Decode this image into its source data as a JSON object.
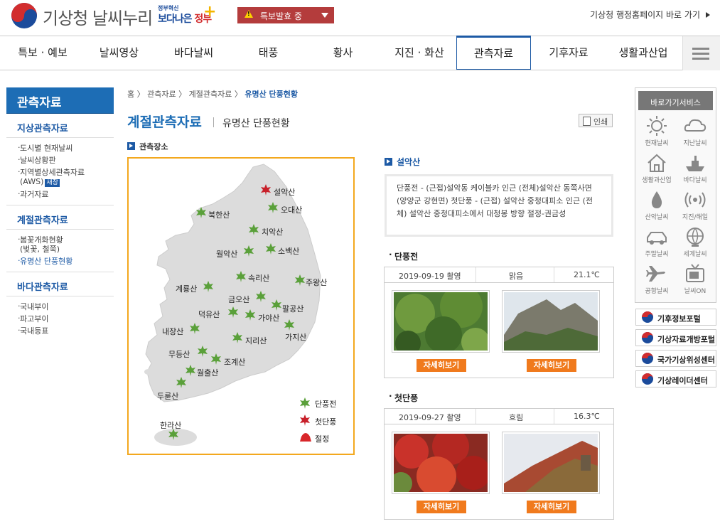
{
  "header": {
    "site_name": "기상청 날씨누리",
    "gov_slogan_small": "정부혁신",
    "gov_slogan_a": "보다나은",
    "gov_slogan_b": "정부",
    "alert_label": "특보발효 중",
    "kma_link": "기상청 행정홈페이지 바로 가기"
  },
  "gnb": [
    "특보 · 예보",
    "날씨영상",
    "바다날씨",
    "태풍",
    "황사",
    "지진 · 화산",
    "관측자료",
    "기후자료",
    "생활과산업"
  ],
  "gnb_active": "관측자료",
  "lnb": {
    "title": "관측자료",
    "sections": [
      {
        "label": "지상관측자료",
        "items": [
          "도시별 현재날씨",
          "날씨상황판",
          "지역별상세관측자료",
          "(AWS)",
          "과거자료"
        ],
        "new_badge": "새창"
      },
      {
        "label": "계절관측자료",
        "items": [
          "봄꽃개화현황",
          "(벚꽃, 철쭉)",
          "유명산 단풍현황"
        ]
      },
      {
        "label": "바다관측자료",
        "items": [
          "국내부이",
          "파고부이",
          "국내등표"
        ]
      }
    ]
  },
  "breadcrumb": {
    "home": "홈",
    "l1": "관측자료",
    "l2": "계절관측자료",
    "current": "유명산 단풍현황"
  },
  "page": {
    "title": "계절관측자료",
    "subtitle": "유명산 단풍현황",
    "print": "인쇄",
    "location_heading": "관측장소"
  },
  "map": {
    "mountains": [
      "설악산",
      "오대산",
      "북한산",
      "치악산",
      "월악산",
      "소백산",
      "속리산",
      "주왕산",
      "계룡산",
      "금오산",
      "팔공산",
      "덕유산",
      "가야산",
      "내장산",
      "가지산",
      "지리산",
      "무등산",
      "조계산",
      "월출산",
      "두륜산",
      "한라산"
    ],
    "legend": {
      "peak": "단풍전",
      "first": "첫단풍",
      "full": "절정"
    }
  },
  "detail": {
    "mountain": "설악산",
    "description": "단풍전 - (근접)설악동 케이블카 인근 (전체)설악산 동쪽사면(양양군 강현면) 첫단풍 - (근접) 설악산 중청대피소 인근 (전체) 설악산 중청대피소에서 대청봉 방향 절정-권금성",
    "sections": [
      {
        "label": "단풍전",
        "date": "2019-09-19 촬영",
        "weather": "맑음",
        "temp": "21.1℃",
        "button": "자세히보기"
      },
      {
        "label": "첫단풍",
        "date": "2019-09-27 촬영",
        "weather": "흐림",
        "temp": "16.3℃",
        "button": "자세히보기"
      }
    ]
  },
  "quick": {
    "title": "바로가기서비스",
    "items": [
      "현재날씨",
      "지난날씨",
      "생활과산업",
      "바다날씨",
      "산악날씨",
      "지진/해일",
      "주말날씨",
      "세계날씨",
      "공항날씨",
      "날씨ON"
    ]
  },
  "portals": [
    "기후정보포털",
    "기상자료개방포털",
    "국가기상위성센터",
    "기상레이더센터"
  ],
  "colors": {
    "brand_blue": "#1d6db5",
    "alert_red": "#b43c3c",
    "button_orange": "#f07a1d",
    "map_border": "#f3a81e"
  }
}
